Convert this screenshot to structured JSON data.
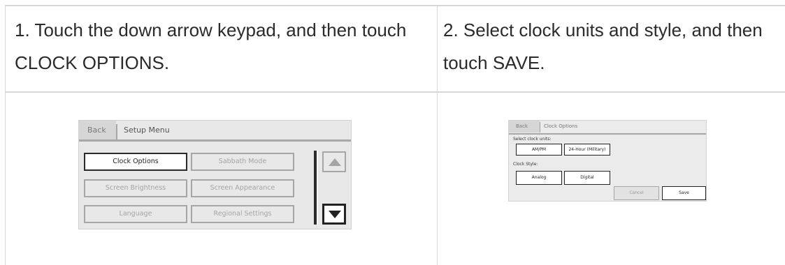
{
  "steps": [
    {
      "text": "1. Touch the down arrow keypad, and then touch CLOCK OPTIONS."
    },
    {
      "text": "2. Select clock units and style, and then touch SAVE."
    }
  ],
  "setup_menu": {
    "back_label": "Back",
    "title": "Setup Menu",
    "buttons": [
      "Clock Options",
      "Sabbath Mode",
      "Screen Brightness",
      "Screen Appearance",
      "Language",
      "Regional Settings"
    ],
    "active_button": "Clock Options",
    "scroll_up_icon": "triangle-up-icon",
    "scroll_down_icon": "triangle-down-icon"
  },
  "clock_options": {
    "back_label": "Back",
    "title": "Clock Options",
    "units_label": "Select clock units:",
    "units_options": [
      "AM/PM",
      "24-Hour (Military)"
    ],
    "style_label": "Clock Style:",
    "style_options": [
      "Analog",
      "Digital"
    ],
    "cancel_label": "Cancel",
    "save_label": "Save"
  }
}
